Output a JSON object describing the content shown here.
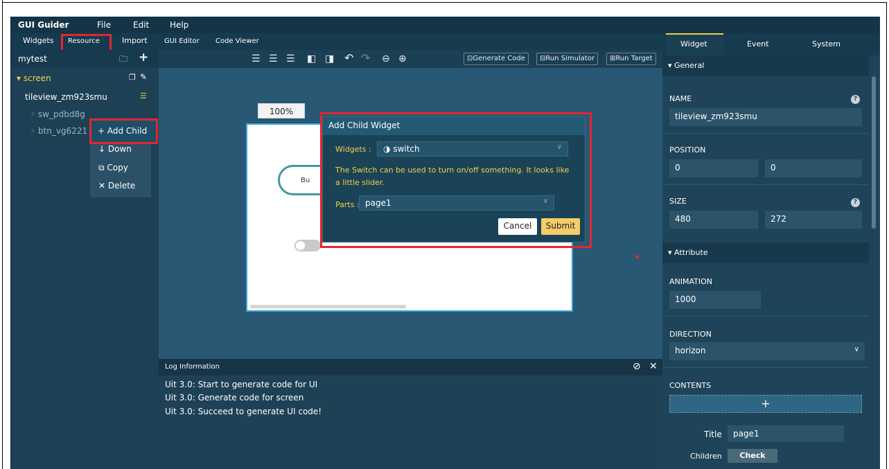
{
  "menu": {
    "brand": "GUI Guider",
    "items": [
      "File",
      "Edit",
      "Help"
    ]
  },
  "left_tabs": [
    "Widgets",
    "Resource",
    "Import"
  ],
  "project": {
    "name": "mytest"
  },
  "tree": {
    "screen": "screen",
    "tileview": "tileview_zm923smu",
    "child1": "sw_pdbd8g",
    "child2": "btn_vg6221"
  },
  "context_menu": {
    "add_child": "+ Add Child",
    "down": "↓ Down",
    "copy": "Copy",
    "delete": "✕ Delete"
  },
  "center_tabs": [
    "GUI Editor",
    "Code Viewer"
  ],
  "toolbar": {
    "generate": "Generate Code",
    "simulator": "Run Simulator",
    "target": "Run Target"
  },
  "canvas": {
    "zoom": "100%",
    "button_text": "Bu"
  },
  "dialog": {
    "title": "Add Child Widget",
    "widgets_label": "Widgets :",
    "widgets_value": "switch",
    "description": "The Switch can be used to turn on/off something. It looks like a little slider.",
    "parts_label": "Parts :",
    "parts_value": "page1",
    "cancel": "Cancel",
    "submit": "Submit"
  },
  "log": {
    "title": "Log Information",
    "lines": [
      "Uit 3.0: Start to generate code for UI",
      "Uit 3.0: Generate code for screen",
      "Uit 3.0: Succeed to generate UI code!"
    ]
  },
  "right_tabs": [
    "Widget",
    "Event",
    "System"
  ],
  "props": {
    "general": "▾ General",
    "name_label": "NAME",
    "name_value": "tileview_zm923smu",
    "position_label": "POSITION",
    "pos_x": "0",
    "pos_y": "0",
    "size_label": "SIZE",
    "size_w": "480",
    "size_h": "272",
    "attribute": "▾ Attribute",
    "animation_label": "ANIMATION",
    "animation_value": "1000",
    "direction_label": "DIRECTION",
    "direction_value": "horizon",
    "contents_label": "CONTENTS",
    "plus": "+",
    "title_label": "Title",
    "title_value": "page1",
    "children_label": "Children",
    "check": "Check"
  },
  "colors": {
    "highlight_red": "#e3262f",
    "accent_yellow": "#f2cf47",
    "submit_yellow": "#f5cc6a"
  }
}
